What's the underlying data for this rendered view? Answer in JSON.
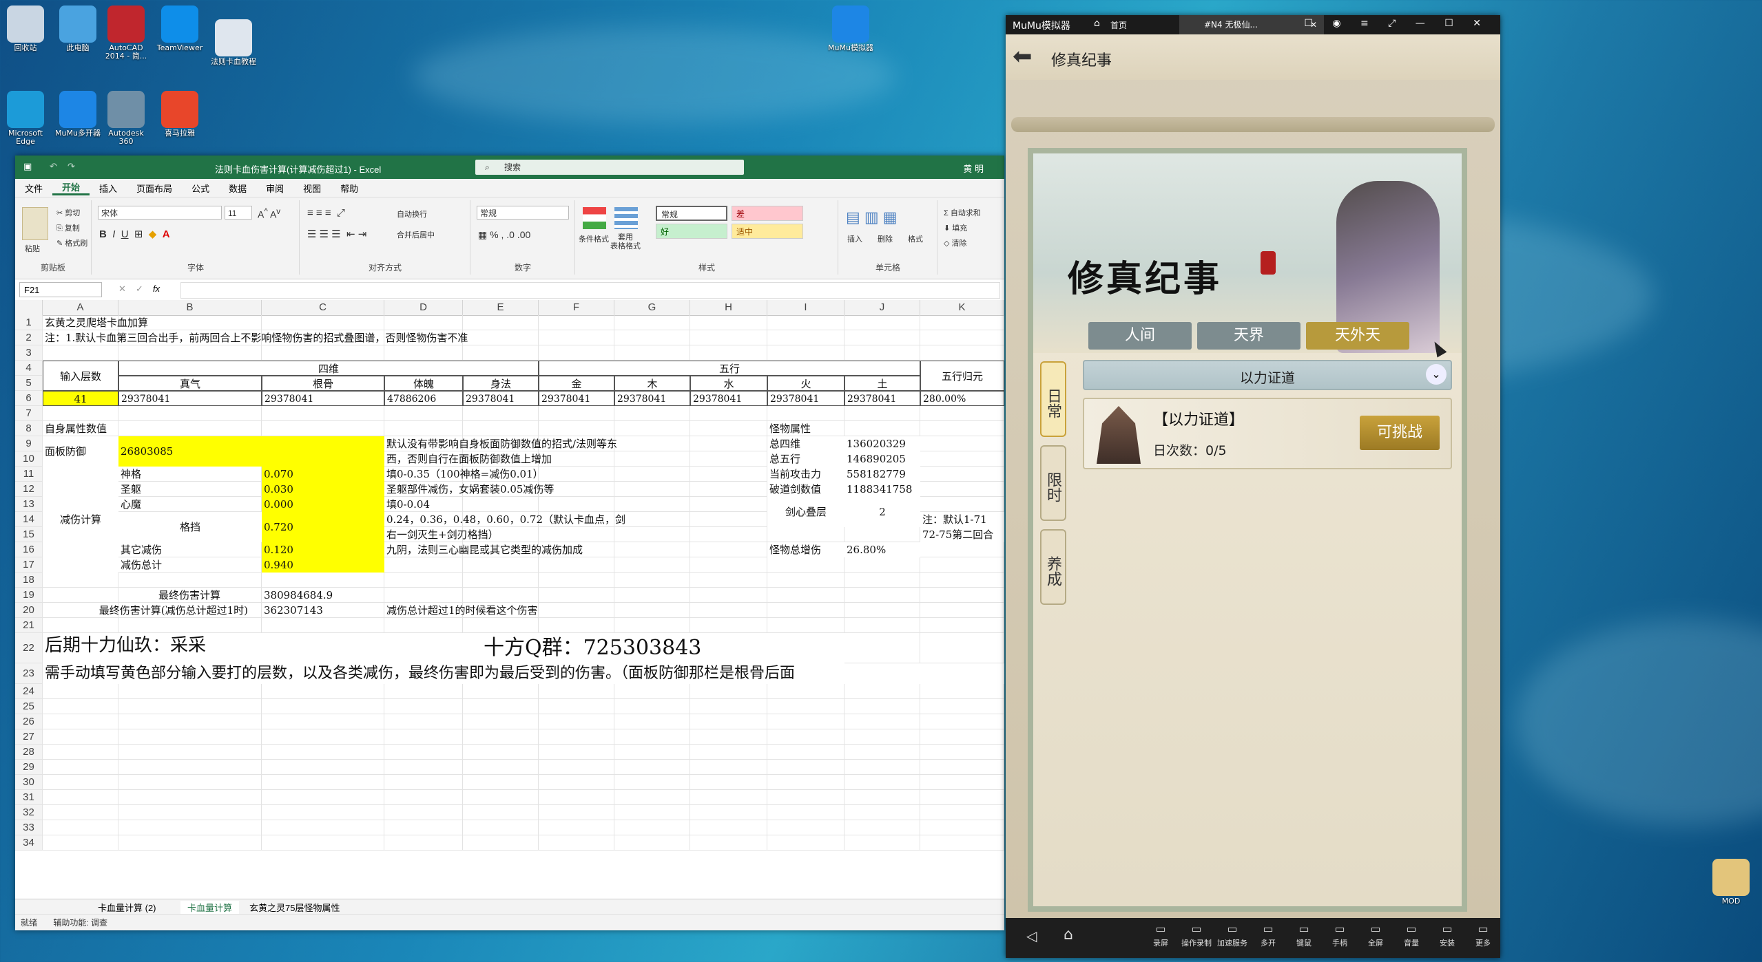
{
  "desktop": {
    "icons": [
      {
        "label": "回收站",
        "color": "#c9d6e3"
      },
      {
        "label": "此电脑",
        "color": "#4aa3e0"
      },
      {
        "label": "AutoCAD 2014 - 简...",
        "color": "#c0262d"
      },
      {
        "label": "TeamViewer",
        "color": "#0e8ee9"
      },
      {
        "label": "法则卡血教程",
        "color": "#dfe6ee"
      },
      {
        "label": "Microsoft Edge",
        "color": "#1c9bd8"
      },
      {
        "label": "MuMu多开器",
        "color": "#1d86e5"
      },
      {
        "label": "Autodesk 360",
        "color": "#6f8fa7"
      },
      {
        "label": "喜马拉雅",
        "color": "#e8462a"
      },
      {
        "label": "MuMu模拟器",
        "color": "#1d86e5"
      },
      {
        "label": "MOD",
        "color": "#e3c57b"
      }
    ]
  },
  "excel": {
    "title": "法则卡血伤害计算(计算减伤超过1) - Excel",
    "search": "搜索",
    "user": "黄 明",
    "menu": [
      "文件",
      "开始",
      "插入",
      "页面布局",
      "公式",
      "数据",
      "审阅",
      "视图",
      "帮助"
    ],
    "ribbon": {
      "clipboard": {
        "paste": "粘贴",
        "cut": "剪切",
        "copy": "复制",
        "format_painter": "格式刷",
        "label": "剪贴板"
      },
      "font": {
        "name": "宋体",
        "size": "11",
        "label": "字体"
      },
      "align": {
        "wrap": "自动换行",
        "merge": "合并后居中",
        "label": "对齐方式"
      },
      "number": {
        "format": "常规",
        "label": "数字"
      },
      "styles": {
        "cond": "条件格式",
        "table": "套用\n表格格式",
        "normal": "常规",
        "bad": "差",
        "good": "好",
        "neutral": "适中",
        "label": "样式"
      },
      "cells": {
        "insert": "插入",
        "delete": "删除",
        "format": "格式",
        "label": "单元格"
      },
      "edit": {
        "autosum": "自动求和",
        "fill": "填充",
        "clear": "清除"
      }
    },
    "namebox": "F21",
    "fx": "fx",
    "columns": [
      "A",
      "B",
      "C",
      "D",
      "E",
      "F",
      "G",
      "H",
      "I",
      "J",
      "K"
    ],
    "rows": [
      "1",
      "2",
      "3",
      "4",
      "5",
      "6",
      "7",
      "8",
      "9",
      "10",
      "11",
      "12",
      "13",
      "14",
      "15",
      "16",
      "17",
      "18",
      "19",
      "20",
      "21",
      "22",
      "23",
      "24",
      "25",
      "26",
      "27",
      "28",
      "29",
      "30",
      "31",
      "32",
      "33",
      "34"
    ],
    "cells": {
      "r1": "玄黄之灵爬塔卡血加算",
      "r2": "注：1.默认卡血第三回合出手，前两回合上不影响怪物伤害的招式叠图谱，否则怪物伤害不准",
      "input_floor": "输入层数",
      "siwei": "四维",
      "wuxing": "五行",
      "zhenqi": "真气",
      "gengu": "根骨",
      "tipo": "体魄",
      "shenfa": "身法",
      "jin": "金",
      "mu": "木",
      "shui": "水",
      "huo": "火",
      "tu": "土",
      "wuxing_guiyuan": "五行归元",
      "floor_val": "41",
      "v_zhenqi": "29378041",
      "v_gengu": "29378041",
      "v_tipo": "47886206",
      "v_shenfa": "29378041",
      "v_jin": "29378041",
      "v_mu": "29378041",
      "v_shui": "29378041",
      "v_huo": "29378041",
      "v_tu": "29378041",
      "v_guiyuan": "280.00%",
      "self_attr": "自身属性数值",
      "monster_attr": "怪物属性",
      "panel_def": "面板防御",
      "panel_def_val": "26803085",
      "note_def": "默认没有带影响自身板面防御数值的招式/法则等东",
      "note_def2": "西，否则自行在面板防御数值上增加",
      "reduce_calc": "减伤计算",
      "shenge": "神格",
      "shenge_val": "0.070",
      "note_shenge": "填0-0.35（100神格=减伤0.01）",
      "shengqu": "圣躯",
      "shengqu_val": "0.030",
      "note_shengqu": "圣躯部件减伤，女娲套装0.05减伤等",
      "xinmo": "心魔",
      "xinmo_val": "0.000",
      "note_xinmo": "填0-0.04",
      "gedang": "格挡",
      "gedang_val": "0.720",
      "note_gedang": "0.24，0.36，0.48，0.60，0.72（默认卡血点，剑",
      "note_gedang2": "右一剑灭生+剑刃格挡）",
      "other_reduce": "其它减伤",
      "other_val": "0.120",
      "note_other": "九阴，法则三心幽昆或其它类型的减伤加成",
      "reduce_total": "减伤总计",
      "reduce_total_val": "0.940",
      "final_dmg": "最终伤害计算",
      "final_dmg_val": "380984684.9",
      "final_dmg2": "最终伤害计算(减伤总计超过1时)",
      "final_dmg2_val": "362307143",
      "note_final2": "减伤总计超过1的时候看这个伤害",
      "m_total4": "总四维",
      "m_total4_val": "136020329",
      "m_total5": "总五行",
      "m_total5_val": "146890205",
      "m_atk": "当前攻击力",
      "m_atk_val": "558182779",
      "m_pojian": "破道剑数值",
      "m_pojian_val": "1188341758",
      "m_jianxin": "剑心叠层",
      "m_jianxin_val": "2",
      "m_note": "注：默认1-71",
      "m_note2": "72-75第二回合",
      "m_dmgup": "怪物总增伤",
      "m_dmgup_val": "26.80%",
      "big_name": "后期十力仙玖：采采",
      "big_qq": "十方Q群：725303843",
      "instruction": "需手动填写黄色部分输入要打的层数，以及各类减伤，最终伤害即为最后受到的伤害。（面板防御那栏是根骨后面"
    },
    "tabs": [
      "卡血量计算 (2)",
      "卡血量计算",
      "玄黄之灵75层怪物属性"
    ],
    "status": {
      "ready": "就绪",
      "access": "辅助功能: 调查"
    }
  },
  "mumu": {
    "app_name": "MuMu模拟器",
    "home": "首页",
    "tab": "#N4 无极仙...",
    "header": "修真纪事",
    "banner_title": "修真纪事",
    "categories": [
      "人间",
      "天界",
      "天外天"
    ],
    "active_category": 2,
    "side_tabs": [
      "日常",
      "限时",
      "养成"
    ],
    "section": "以力证道",
    "task": {
      "title": "【以力证道】",
      "count": "日次数：0/5",
      "button": "可挑战"
    },
    "toolbar": [
      "录屏",
      "操作录制",
      "加速服务",
      "多开",
      "键鼠",
      "手柄",
      "全屏",
      "音量",
      "安装",
      "更多"
    ]
  }
}
